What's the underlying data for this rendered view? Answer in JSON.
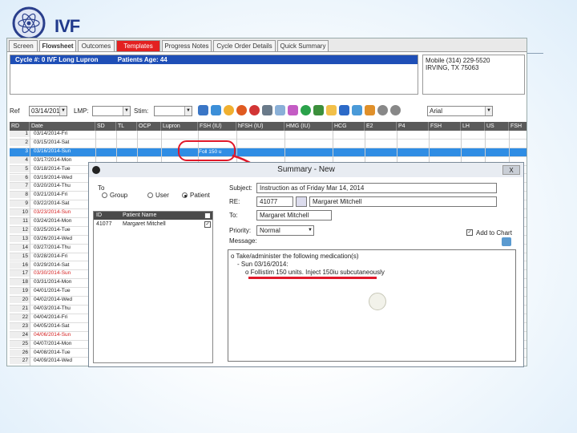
{
  "app": {
    "brand": "IVF",
    "tabs": [
      "Screen",
      "Flowsheet",
      "Outcomes",
      "Templates",
      "Progress Notes",
      "Cycle Order Details",
      "Quick Summary"
    ]
  },
  "cycle": {
    "title": "Cycle #: 0 IVF Long Lupron",
    "age": "Patients Age: 44",
    "contact_line1": "Mobile (314) 229-5520",
    "contact_line2": "IRVING, TX 75063"
  },
  "filters": {
    "ref_label": "Ref",
    "ref_value": "03/14/201",
    "lmp_label": "LMP:",
    "stim_label": "Stim:",
    "font_value": "Arial"
  },
  "grid": {
    "headers": [
      "RD",
      "Date",
      "SD",
      "TL",
      "OCP",
      "Lupron",
      "FSH (IU)",
      "hFSH (IU)",
      "HMG (IU)",
      "HCG",
      "E2",
      "P4",
      "FSH",
      "LH",
      "US",
      "FSH"
    ],
    "rows": [
      {
        "n": "1",
        "date": "03/14/2014-Fri",
        "red": false
      },
      {
        "n": "2",
        "date": "03/15/2014-Sat",
        "red": false
      },
      {
        "n": "3",
        "date": "03/16/2014-Sun",
        "red": false,
        "selected": true,
        "note": "Foll 150 u"
      },
      {
        "n": "4",
        "date": "03/17/2014-Mon",
        "red": false
      },
      {
        "n": "5",
        "date": "03/18/2014-Tue",
        "red": false
      },
      {
        "n": "6",
        "date": "03/19/2014-Wed",
        "red": false
      },
      {
        "n": "7",
        "date": "03/20/2014-Thu",
        "red": false
      },
      {
        "n": "8",
        "date": "03/21/2014-Fri",
        "red": false
      },
      {
        "n": "9",
        "date": "03/22/2014-Sat",
        "red": false
      },
      {
        "n": "10",
        "date": "03/23/2014-Sun",
        "red": true
      },
      {
        "n": "11",
        "date": "03/24/2014-Mon",
        "red": false
      },
      {
        "n": "12",
        "date": "03/25/2014-Tue",
        "red": false
      },
      {
        "n": "13",
        "date": "03/26/2014-Wed",
        "red": false
      },
      {
        "n": "14",
        "date": "03/27/2014-Thu",
        "red": false
      },
      {
        "n": "15",
        "date": "03/28/2014-Fri",
        "red": false
      },
      {
        "n": "16",
        "date": "03/29/2014-Sat",
        "red": false
      },
      {
        "n": "17",
        "date": "03/30/2014-Sun",
        "red": true
      },
      {
        "n": "18",
        "date": "03/31/2014-Mon",
        "red": false
      },
      {
        "n": "19",
        "date": "04/01/2014-Tue",
        "red": false
      },
      {
        "n": "20",
        "date": "04/02/2014-Wed",
        "red": false
      },
      {
        "n": "21",
        "date": "04/03/2014-Thu",
        "red": false
      },
      {
        "n": "22",
        "date": "04/04/2014-Fri",
        "red": false
      },
      {
        "n": "23",
        "date": "04/05/2014-Sat",
        "red": false
      },
      {
        "n": "24",
        "date": "04/06/2014-Sun",
        "red": true
      },
      {
        "n": "25",
        "date": "04/07/2014-Mon",
        "red": false
      },
      {
        "n": "26",
        "date": "04/08/2014-Tue",
        "red": false
      },
      {
        "n": "27",
        "date": "04/09/2014-Wed",
        "red": false
      }
    ]
  },
  "dialog": {
    "title": "Summary - New",
    "close": "X",
    "to_label": "To",
    "radio_group": "Group",
    "radio_user": "User",
    "radio_patient": "Patient",
    "subject_label": "Subject:",
    "subject_value": "Instruction as of Friday Mar 14, 2014",
    "re_label": "RE:",
    "re_id": "41077",
    "re_name": "Margaret Mitchell",
    "to_field_label": "To:",
    "to_value": "Margaret Mitchell",
    "priority_label": "Priority:",
    "priority_value": "Normal",
    "add_chart_label": "Add to Chart",
    "message_label": "Message:",
    "patient_table_headers": [
      "ID",
      "Patient Name"
    ],
    "patient_id": "41077",
    "patient_name": "Margaret Mitchell",
    "msg_line1": "o Take/administer the following medication(s)",
    "msg_line2": "- Sun 03/16/2014:",
    "msg_line3": "o Follistim 150 units. Inject 150iu subcutaneously"
  }
}
